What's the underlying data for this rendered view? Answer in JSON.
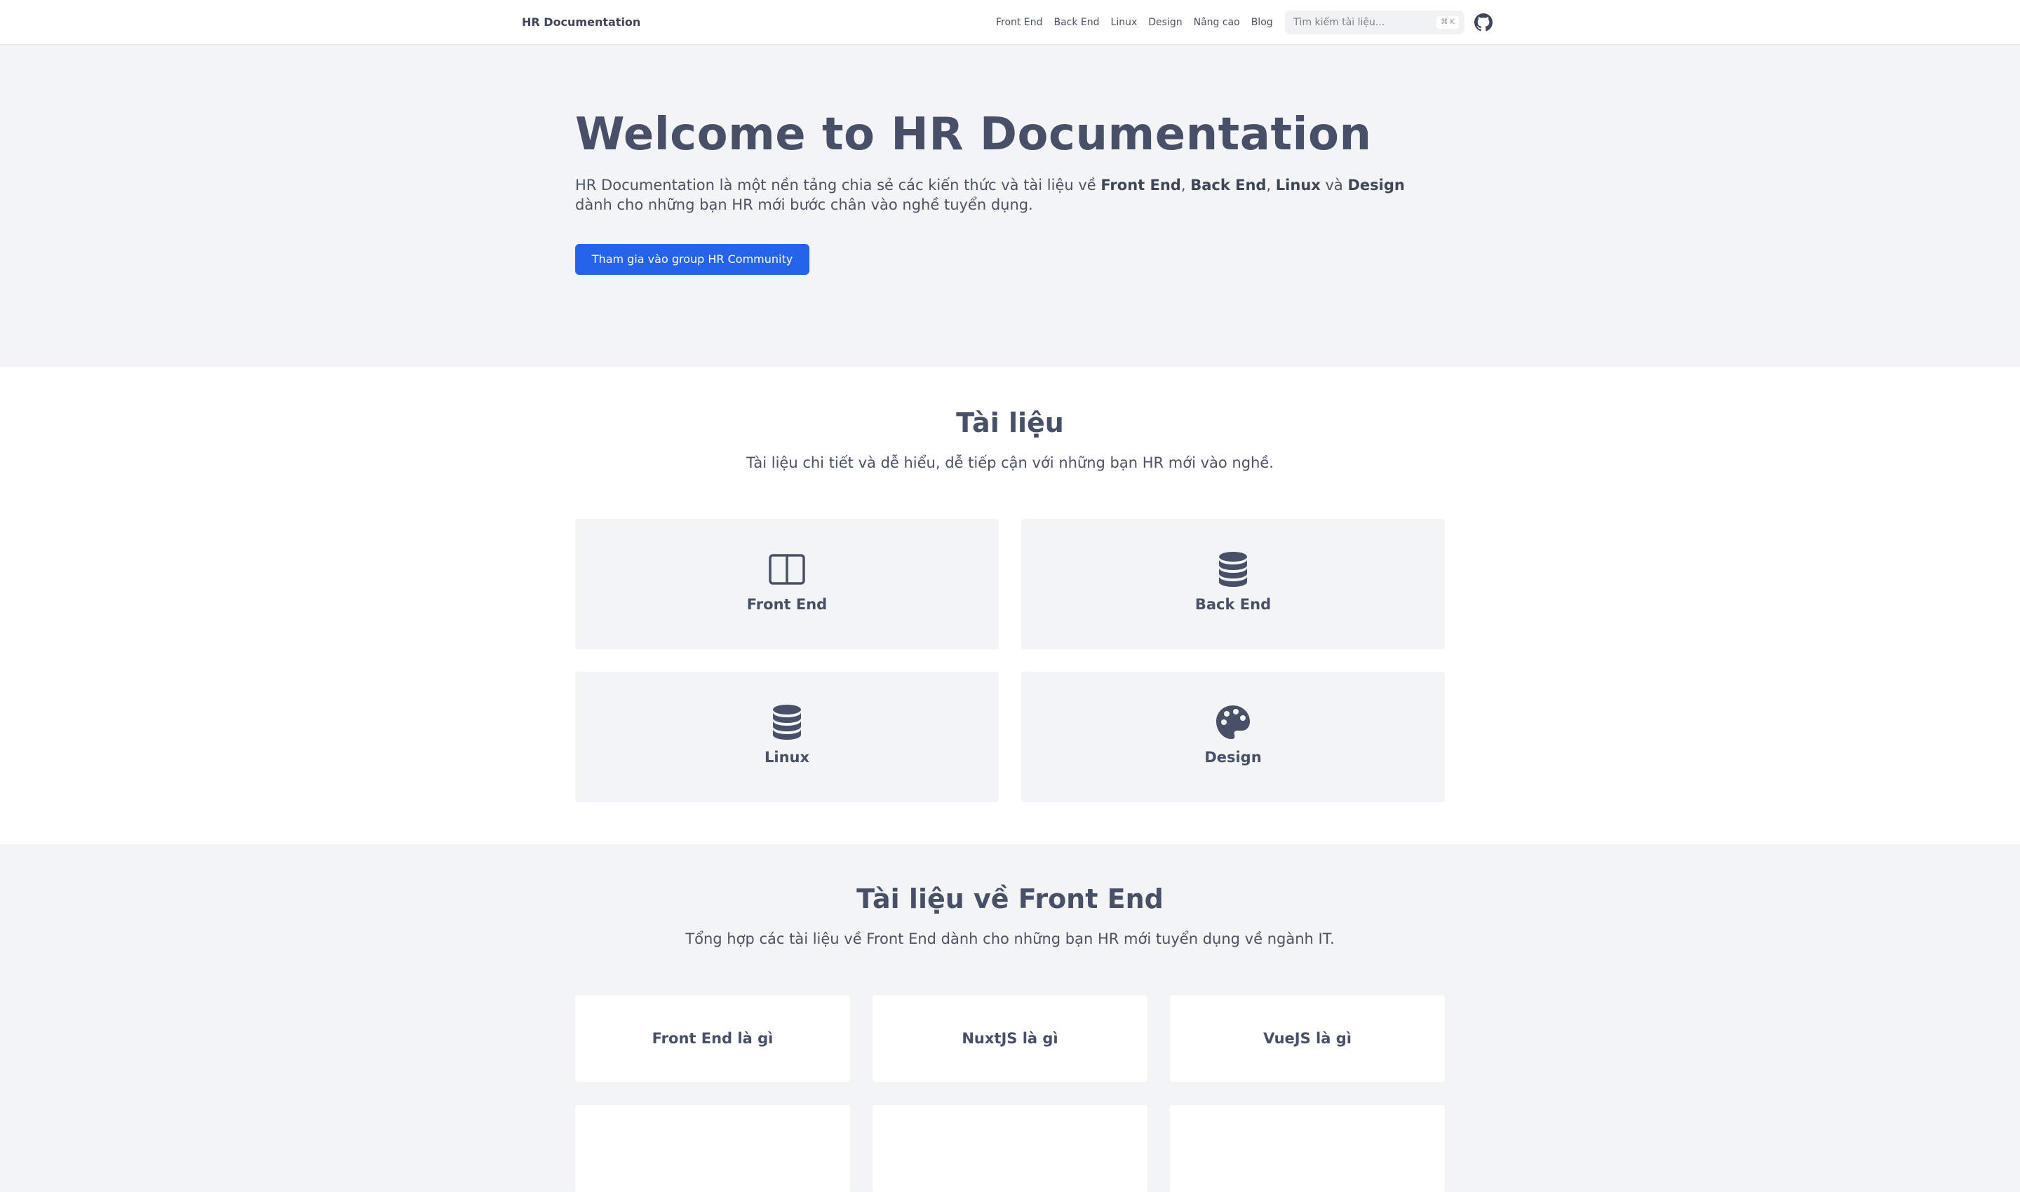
{
  "header": {
    "brand": "HR Documentation",
    "nav": [
      "Front End",
      "Back End",
      "Linux",
      "Design",
      "Nâng cao",
      "Blog"
    ],
    "search_placeholder": "Tìm kiếm tài liệu...",
    "search_shortcut": "⌘ K",
    "github_icon": "github-icon"
  },
  "hero": {
    "title": "Welcome to HR Documentation",
    "desc_parts": {
      "p1": "HR Documentation là một nền tảng chia sẻ các kiến thức và tài liệu về ",
      "b1": "Front End",
      "p2": ", ",
      "b2": "Back End",
      "p3": ", ",
      "b3": "Linux",
      "p4": " và ",
      "b4": "Design",
      "p5": " dành cho những bạn HR mới bước chân vào nghề tuyển dụng."
    },
    "cta_label": "Tham gia vào group HR Community",
    "cta_color": "#2563eb"
  },
  "docs": {
    "title": "Tài liệu",
    "subtitle": "Tài liệu chi tiết và dễ hiểu, dễ tiếp cận với những bạn HR mới vào nghề.",
    "cards": [
      {
        "label": "Front End",
        "icon": "columns-icon"
      },
      {
        "label": "Back End",
        "icon": "database-icon"
      },
      {
        "label": "Linux",
        "icon": "database-icon"
      },
      {
        "label": "Design",
        "icon": "palette-icon"
      }
    ]
  },
  "frontend": {
    "title": "Tài liệu về Front End",
    "subtitle": "Tổng hợp các tài liệu về Front End dành cho những bạn HR mới tuyển dụng về ngành IT.",
    "cards": [
      "Front End là gì",
      "NuxtJS là gì",
      "VueJS là gì",
      "",
      "",
      ""
    ]
  }
}
